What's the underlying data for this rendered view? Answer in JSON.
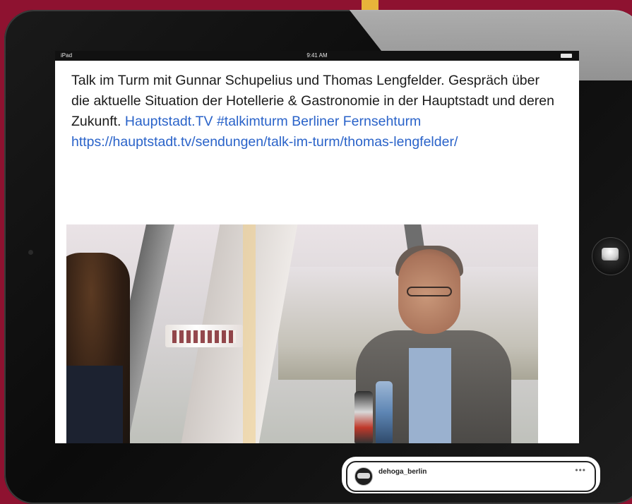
{
  "status_bar": {
    "left": "iPad",
    "time": "9:41 AM"
  },
  "post": {
    "text": "Talk im Turm mit Gunnar Schupelius und Thomas Lengfelder. Gespräch über die aktuelle Situation der Hotellerie & Gastronomie in der Hauptstadt und deren Zukunft.",
    "links": [
      "Hauptstadt.TV",
      "#talkimturm",
      "Berliner Fernsehturm",
      "https://hauptstadt.tv/sendungen/talk-im-turm/thomas-lengfelder/"
    ],
    "media_name": "talk-im-turm-photo"
  },
  "post_header": {
    "username": "dehoga_berlin",
    "more_icon": "more-icon",
    "avatar_icon": "avatar-icon"
  },
  "colors": {
    "background": "#8e1230",
    "accent": "#e8b43a",
    "link": "#2a63c9"
  }
}
